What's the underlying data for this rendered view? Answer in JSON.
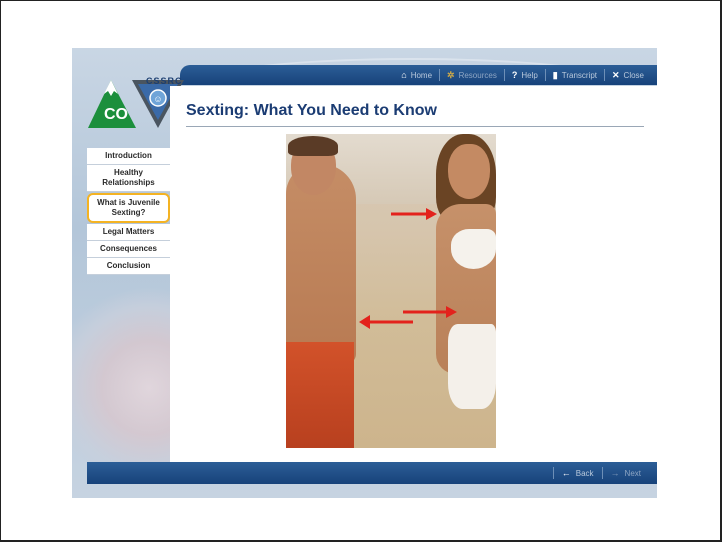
{
  "header": {
    "logo_org": "CSSRC",
    "logo_state": "CO",
    "nav": [
      {
        "label": "Home",
        "icon": "home-icon"
      },
      {
        "label": "Resources",
        "icon": "gear-icon"
      },
      {
        "label": "Help",
        "icon": "question-icon"
      },
      {
        "label": "Transcript",
        "icon": "transcript-icon"
      },
      {
        "label": "Close",
        "icon": "close-icon"
      }
    ]
  },
  "page": {
    "title": "Sexting: What You Need to Know"
  },
  "sidebar": {
    "items": [
      {
        "label": "Introduction"
      },
      {
        "label": "Healthy Relationships"
      },
      {
        "label": "What is Juvenile Sexting?"
      },
      {
        "label": "Legal Matters"
      },
      {
        "label": "Consequences"
      },
      {
        "label": "Conclusion"
      }
    ],
    "active_index": 2
  },
  "footer": {
    "back_label": "Back",
    "next_label": "Next"
  },
  "colors": {
    "nav_bar": "#1f4f8a",
    "title": "#1b3c73",
    "active_outline": "#f4b323",
    "arrow": "#e3221c"
  }
}
